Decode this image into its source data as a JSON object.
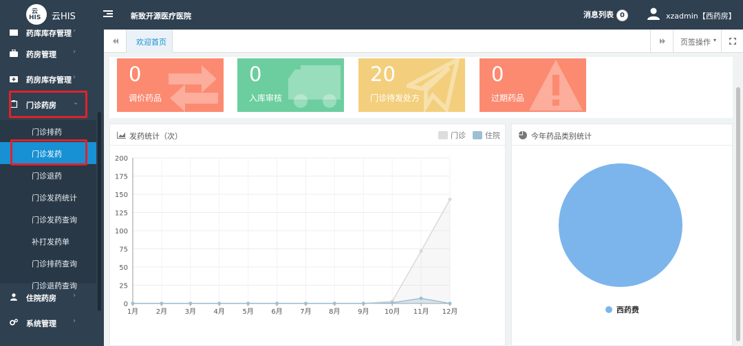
{
  "header": {
    "logo_top": "云",
    "logo_bottom": "HIS",
    "app_name": "云HIS",
    "hospital": "新致开源医疗医院",
    "messages_label": "消息列表",
    "messages_count": "0",
    "user": "xzadmin【西药房】"
  },
  "sidebar": {
    "items": [
      {
        "label": "药库库存管理"
      },
      {
        "label": "药房管理"
      },
      {
        "label": "药房库存管理"
      },
      {
        "label": "门诊药房"
      },
      {
        "label": "住院药房"
      },
      {
        "label": "系统管理"
      }
    ],
    "subitems": [
      {
        "label": "门诊排药"
      },
      {
        "label": "门诊发药"
      },
      {
        "label": "门诊退药"
      },
      {
        "label": "门诊发药统计"
      },
      {
        "label": "门诊发药查询"
      },
      {
        "label": "补打发药单"
      },
      {
        "label": "门诊排药查询"
      },
      {
        "label": "门诊退药查询"
      }
    ]
  },
  "tabs": {
    "active": "欢迎首页",
    "page_ops": "页签操作"
  },
  "stats": [
    {
      "value": "0",
      "label": "调价药品",
      "color": "#fb8a71"
    },
    {
      "value": "0",
      "label": "入库审核",
      "color": "#6cce9f"
    },
    {
      "value": "20",
      "label": "门诊待发处方",
      "color": "#f3cf7d"
    },
    {
      "value": "0",
      "label": "过期药品",
      "color": "#fb8a71"
    }
  ],
  "line_panel": {
    "title": "发药统计（次）"
  },
  "pie_panel": {
    "title": "今年药品类别统计"
  },
  "chart_data": [
    {
      "type": "area",
      "categories": [
        "1月",
        "2月",
        "3月",
        "4月",
        "5月",
        "6月",
        "7月",
        "8月",
        "9月",
        "10月",
        "11月",
        "12月"
      ],
      "series": [
        {
          "name": "门诊",
          "color": "#d9d9d9",
          "values": [
            0,
            0,
            0,
            0,
            0,
            0,
            0,
            0,
            0,
            3,
            72,
            143
          ]
        },
        {
          "name": "住院",
          "color": "#9dbfd4",
          "values": [
            0,
            0,
            0,
            0,
            0,
            0,
            0,
            0,
            0,
            1,
            7,
            0
          ]
        }
      ],
      "ylim": [
        0,
        200
      ],
      "yticks": [
        "0",
        "25",
        "50",
        "75",
        "100",
        "125",
        "150",
        "175",
        "200"
      ],
      "grid": true,
      "legend": "top-right"
    },
    {
      "type": "pie",
      "slices": [
        {
          "name": "西药费",
          "value": 100,
          "color": "#7cb5ec"
        }
      ],
      "legend": "bottom"
    }
  ]
}
